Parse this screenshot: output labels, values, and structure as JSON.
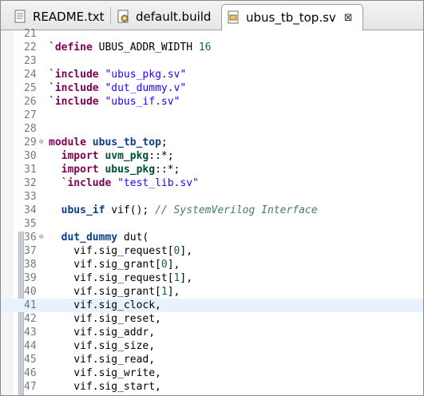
{
  "tabs": [
    {
      "label": "README.txt",
      "icon": "text-file-icon",
      "active": false
    },
    {
      "label": "default.build",
      "icon": "build-file-icon",
      "active": false
    },
    {
      "label": "ubus_tb_top.sv",
      "icon": "sv-file-icon",
      "active": true,
      "close": "⊠"
    }
  ],
  "lines": [
    {
      "n": "21",
      "fold": "",
      "hl": false,
      "tokens": []
    },
    {
      "n": "22",
      "fold": "",
      "hl": false,
      "tokens": [
        {
          "c": "pl",
          "t": "`"
        },
        {
          "c": "kw",
          "t": "define"
        },
        {
          "c": "pl",
          "t": " UBUS_ADDR_WIDTH "
        },
        {
          "c": "num",
          "t": "16"
        }
      ]
    },
    {
      "n": "23",
      "fold": "",
      "hl": false,
      "tokens": []
    },
    {
      "n": "24",
      "fold": "",
      "hl": false,
      "tokens": [
        {
          "c": "pl",
          "t": "`"
        },
        {
          "c": "kw",
          "t": "include"
        },
        {
          "c": "pl",
          "t": " "
        },
        {
          "c": "str",
          "t": "\"ubus_pkg.sv\""
        }
      ]
    },
    {
      "n": "25",
      "fold": "",
      "hl": false,
      "tokens": [
        {
          "c": "pl",
          "t": "`"
        },
        {
          "c": "kw",
          "t": "include"
        },
        {
          "c": "pl",
          "t": " "
        },
        {
          "c": "str",
          "t": "\"dut_dummy.v\""
        }
      ]
    },
    {
      "n": "26",
      "fold": "",
      "hl": false,
      "tokens": [
        {
          "c": "pl",
          "t": "`"
        },
        {
          "c": "kw",
          "t": "include"
        },
        {
          "c": "pl",
          "t": " "
        },
        {
          "c": "str",
          "t": "\"ubus_if.sv\""
        }
      ]
    },
    {
      "n": "27",
      "fold": "",
      "hl": false,
      "tokens": []
    },
    {
      "n": "28",
      "fold": "",
      "hl": false,
      "tokens": []
    },
    {
      "n": "29",
      "fold": "⊖",
      "hl": false,
      "tokens": [
        {
          "c": "kw",
          "t": "module"
        },
        {
          "c": "pl",
          "t": " "
        },
        {
          "c": "tyb",
          "t": "ubus_tb_top"
        },
        {
          "c": "pl",
          "t": ";"
        }
      ]
    },
    {
      "n": "30",
      "fold": "",
      "hl": false,
      "tokens": [
        {
          "c": "pl",
          "t": "  "
        },
        {
          "c": "kw",
          "t": "import"
        },
        {
          "c": "pl",
          "t": " "
        },
        {
          "c": "ty",
          "t": "uvm_pkg"
        },
        {
          "c": "pl",
          "t": "::*;"
        }
      ]
    },
    {
      "n": "31",
      "fold": "",
      "hl": false,
      "tokens": [
        {
          "c": "pl",
          "t": "  "
        },
        {
          "c": "kw",
          "t": "import"
        },
        {
          "c": "pl",
          "t": " "
        },
        {
          "c": "ty",
          "t": "ubus_pkg"
        },
        {
          "c": "pl",
          "t": "::*;"
        }
      ]
    },
    {
      "n": "32",
      "fold": "",
      "hl": false,
      "tokens": [
        {
          "c": "pl",
          "t": "  `"
        },
        {
          "c": "kw",
          "t": "include"
        },
        {
          "c": "pl",
          "t": " "
        },
        {
          "c": "str",
          "t": "\"test_lib.sv\""
        }
      ]
    },
    {
      "n": "33",
      "fold": "",
      "hl": false,
      "tokens": []
    },
    {
      "n": "34",
      "fold": "",
      "hl": false,
      "tokens": [
        {
          "c": "pl",
          "t": "  "
        },
        {
          "c": "tyb",
          "t": "ubus_if"
        },
        {
          "c": "pl",
          "t": " vif(); "
        },
        {
          "c": "cm",
          "t": "// SystemVerilog Interface"
        }
      ]
    },
    {
      "n": "35",
      "fold": "",
      "hl": false,
      "tokens": []
    },
    {
      "n": "36",
      "fold": "⊖",
      "hl": false,
      "tokens": [
        {
          "c": "pl",
          "t": "  "
        },
        {
          "c": "tyb",
          "t": "dut_dummy"
        },
        {
          "c": "pl",
          "t": " dut("
        }
      ]
    },
    {
      "n": "37",
      "fold": "",
      "hl": false,
      "tokens": [
        {
          "c": "pl",
          "t": "    vif.sig_request["
        },
        {
          "c": "num",
          "t": "0"
        },
        {
          "c": "pl",
          "t": "],"
        }
      ]
    },
    {
      "n": "38",
      "fold": "",
      "hl": false,
      "tokens": [
        {
          "c": "pl",
          "t": "    vif.sig_grant["
        },
        {
          "c": "num",
          "t": "0"
        },
        {
          "c": "pl",
          "t": "],"
        }
      ]
    },
    {
      "n": "39",
      "fold": "",
      "hl": false,
      "tokens": [
        {
          "c": "pl",
          "t": "    vif.sig_request["
        },
        {
          "c": "num",
          "t": "1"
        },
        {
          "c": "pl",
          "t": "],"
        }
      ]
    },
    {
      "n": "40",
      "fold": "",
      "hl": false,
      "tokens": [
        {
          "c": "pl",
          "t": "    vif.sig_grant["
        },
        {
          "c": "num",
          "t": "1"
        },
        {
          "c": "pl",
          "t": "],"
        }
      ]
    },
    {
      "n": "41",
      "fold": "",
      "hl": true,
      "tokens": [
        {
          "c": "pl",
          "t": "    vif.sig_clock,"
        }
      ]
    },
    {
      "n": "42",
      "fold": "",
      "hl": false,
      "tokens": [
        {
          "c": "pl",
          "t": "    vif.sig_reset,"
        }
      ]
    },
    {
      "n": "43",
      "fold": "",
      "hl": false,
      "tokens": [
        {
          "c": "pl",
          "t": "    vif.sig_addr,"
        }
      ]
    },
    {
      "n": "44",
      "fold": "",
      "hl": false,
      "tokens": [
        {
          "c": "pl",
          "t": "    vif.sig_size,"
        }
      ]
    },
    {
      "n": "45",
      "fold": "",
      "hl": false,
      "tokens": [
        {
          "c": "pl",
          "t": "    vif.sig_read,"
        }
      ]
    },
    {
      "n": "46",
      "fold": "",
      "hl": false,
      "tokens": [
        {
          "c": "pl",
          "t": "    vif.sig_write,"
        }
      ]
    },
    {
      "n": "47",
      "fold": "",
      "hl": false,
      "tokens": [
        {
          "c": "pl",
          "t": "    vif.sig_start,"
        }
      ]
    }
  ]
}
